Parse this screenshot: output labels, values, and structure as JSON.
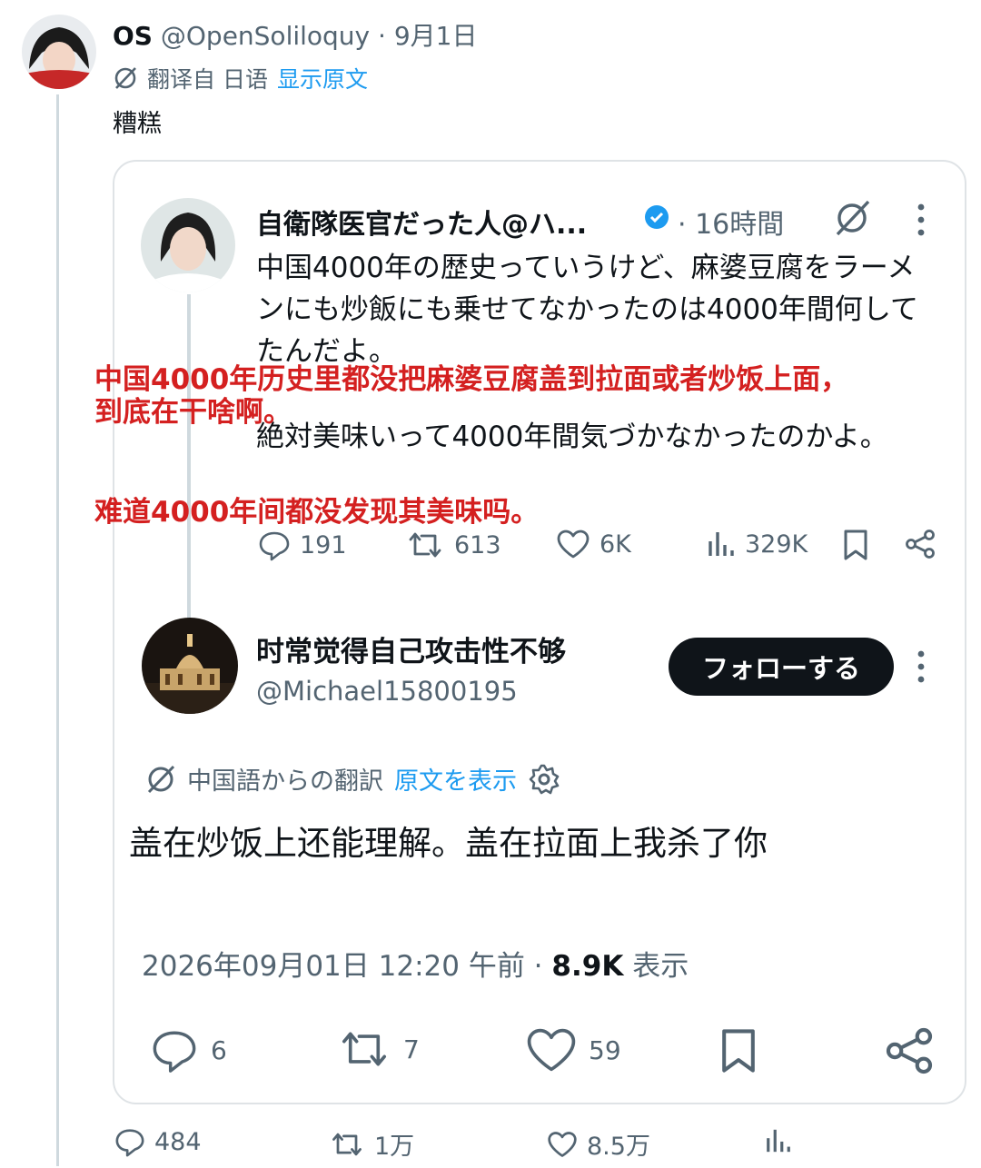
{
  "post": {
    "author_name": "OS",
    "author_handle": "@OpenSoliloquy",
    "date": "9月1日",
    "translated_from": "翻译自 日语",
    "show_original": "显示原文",
    "text": "糟糕",
    "stats": {
      "replies": "484",
      "reposts": "1万",
      "likes": "8.5万"
    }
  },
  "quoted": {
    "author_name": "自衛隊医官だった人@ハ...",
    "time": "· 16時間",
    "text_line1": "中国4000年の歴史っていうけど、麻婆豆腐をラーメンにも炒飯にも乗せてなかったのは4000年間何してたんだよ。",
    "text_line2": "絶対美味いって4000年間気づかなかったのかよ。",
    "stats": {
      "replies": "191",
      "reposts": "613",
      "likes": "6K",
      "views": "329K"
    }
  },
  "annotations": {
    "line1": "中国4000年历史里都没把麻婆豆腐盖到拉面或者炒饭上面，",
    "line2": "到底在干啥啊。",
    "line3": "难道4000年间都没发现其美味吗。"
  },
  "reply": {
    "author_name": "时常觉得自己攻击性不够",
    "author_handle": "@Michael15800195",
    "follow_label": "フォローする",
    "translated_from": "中国語からの翻訳",
    "show_original": "原文を表示",
    "text": "盖在炒饭上还能理解。盖在拉面上我杀了你",
    "timestamp": "2026年09月01日 12:20 午前 · ",
    "views_count": "8.9K",
    "views_label": " 表示",
    "stats": {
      "replies": "6",
      "reposts": "7",
      "likes": "59"
    }
  },
  "colors": {
    "accent": "#1d9bf0",
    "verified": "#1d9bf0",
    "annotation": "#d42020",
    "text": "#0f1419",
    "muted": "#536471"
  },
  "icons": [
    "translate-icon",
    "verified-badge-icon",
    "grok-icon",
    "more-icon",
    "reply-icon",
    "repost-icon",
    "like-icon",
    "views-icon",
    "bookmark-icon",
    "share-icon",
    "settings-icon"
  ]
}
